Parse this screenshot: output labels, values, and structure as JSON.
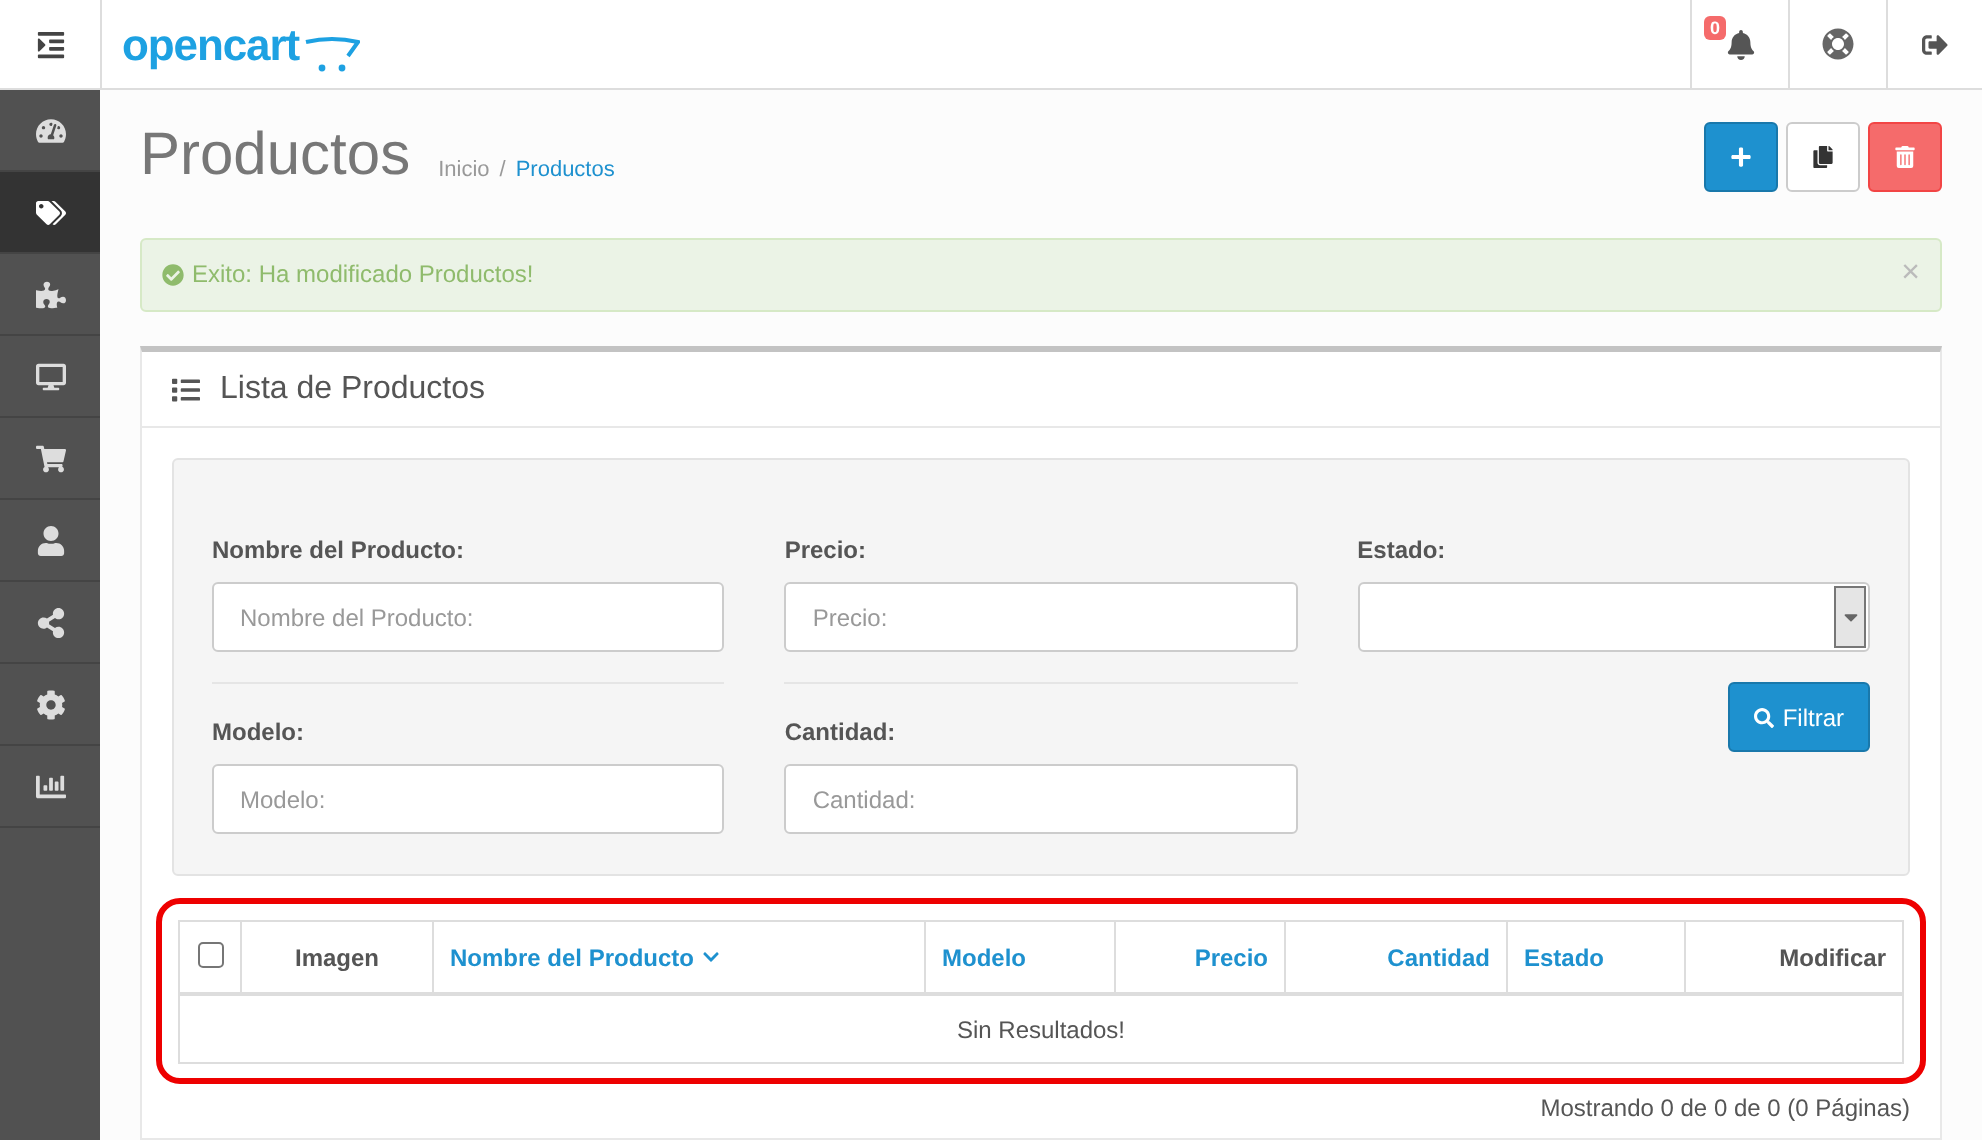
{
  "header": {
    "logo": "opencart",
    "notification_count": "0"
  },
  "sidebar": {
    "items": [
      {
        "selected": false
      },
      {
        "selected": true
      },
      {
        "selected": false
      },
      {
        "selected": false
      },
      {
        "selected": false
      },
      {
        "selected": false
      },
      {
        "selected": false
      },
      {
        "selected": false
      },
      {
        "selected": false
      }
    ]
  },
  "page": {
    "title": "Productos",
    "breadcrumb_separator": "/",
    "breadcrumb": [
      {
        "label": "Inicio",
        "link": false
      },
      {
        "label": "Productos",
        "link": true
      }
    ]
  },
  "actions": [
    {
      "kind": "add"
    },
    {
      "kind": "copy"
    },
    {
      "kind": "delete"
    }
  ],
  "alert": {
    "text": "Exito: Ha modificado Productos!",
    "close": "×"
  },
  "panel": {
    "title": "Lista de Productos"
  },
  "filters": {
    "columns": [
      [
        {
          "kind": "input",
          "label": "Nombre del Producto:",
          "placeholder": "Nombre del Producto:"
        },
        {
          "kind": "input",
          "label": "Modelo:",
          "placeholder": "Modelo:"
        }
      ],
      [
        {
          "kind": "input",
          "label": "Precio:",
          "placeholder": "Precio:"
        },
        {
          "kind": "input",
          "label": "Cantidad:",
          "placeholder": "Cantidad:"
        }
      ],
      [
        {
          "kind": "select",
          "label": "Estado:"
        }
      ]
    ],
    "button": "Filtrar"
  },
  "table": {
    "select_all": {
      "checked": false
    },
    "columns": [
      {
        "label": "Imagen",
        "link": false,
        "sorted": false
      },
      {
        "label": "Nombre del Producto",
        "link": true,
        "sorted": true
      },
      {
        "label": "Modelo",
        "link": true,
        "sorted": false
      },
      {
        "label": "Precio",
        "link": true,
        "sorted": false
      },
      {
        "label": "Cantidad",
        "link": true,
        "sorted": false
      },
      {
        "label": "Estado",
        "link": true,
        "sorted": false
      },
      {
        "label": "Modificar",
        "link": false,
        "sorted": false
      }
    ],
    "empty": "Sin Resultados!"
  },
  "pagination_text": "Mostrando 0 de 0 de 0 (0 Páginas)"
}
